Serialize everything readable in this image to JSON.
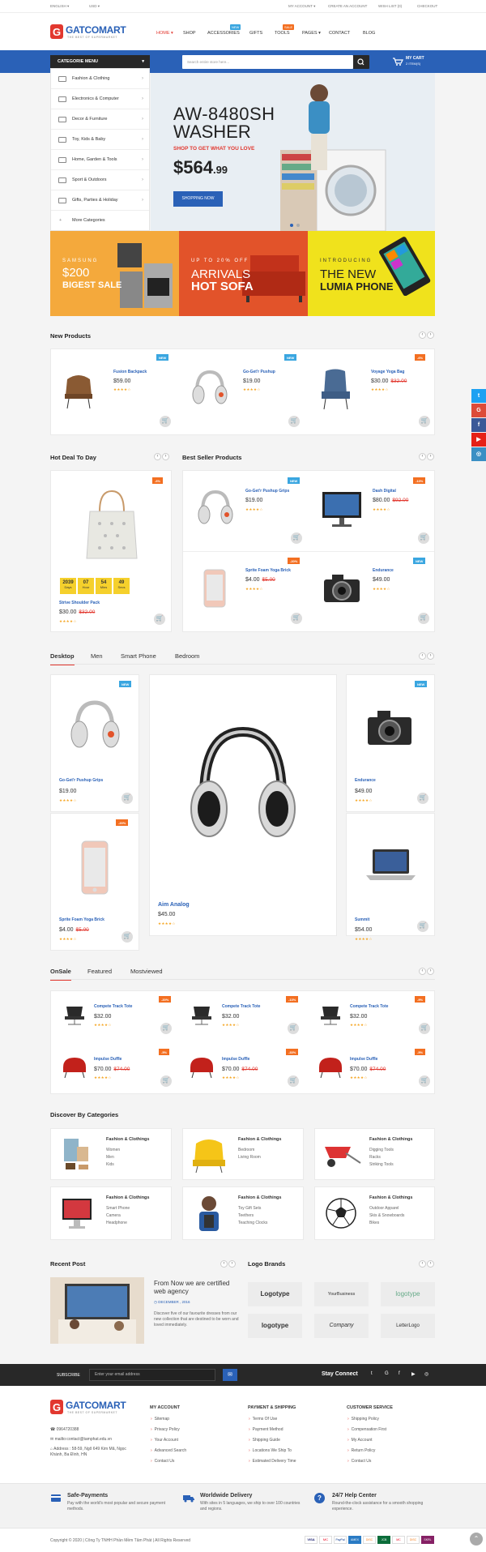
{
  "topbar": {
    "language": "ENGLISH",
    "currency": "USD",
    "my_account": "MY ACCOUNT",
    "create_account": "CREATE AN ACCOUNT",
    "wishlist": "WISH LIST (0)",
    "checkout": "CHECKOUT"
  },
  "header": {
    "logo_letter": "G",
    "logo_name": "GATCOMART",
    "logo_tagline": "THE BEST OF SUPERMARKET",
    "nav": [
      {
        "label": "Home"
      },
      {
        "label": "Shop"
      },
      {
        "label": "Accessories",
        "badge": "NEW"
      },
      {
        "label": "Gifts"
      },
      {
        "label": "Tools",
        "badge": "SALE"
      },
      {
        "label": "Pages"
      },
      {
        "label": "Contact"
      },
      {
        "label": "Blog"
      }
    ]
  },
  "catmenu": {
    "title": "CATEGORIE MENU",
    "items": [
      "Fashion & Clothing",
      "Electronics & Computer",
      "Decor & Furniture",
      "Toy, Kids & Baby",
      "Home, Garden & Tools",
      "Sport & Outdoors",
      "Gifts, Parties & Holiday",
      "More Categories"
    ]
  },
  "search": {
    "placeholder": "Search entire store here..."
  },
  "cart": {
    "title": "MY CART",
    "count": "2 ITEM(S)"
  },
  "hero": {
    "title1": "AW-8480SH",
    "title2": "WASHER",
    "subtitle": "SHOP TO GET WHAT YOU LOVE",
    "price_main": "$564",
    "price_cents": ".99",
    "button": "SHOPPING NOW"
  },
  "promos": [
    {
      "l1": "SAMSUNG",
      "l2": "$200",
      "l3": "BIGEST SALE",
      "bg": "#f4a93c"
    },
    {
      "l1": "UP TO 20% OFF",
      "l2": "ARRIVALS",
      "l3": "HOT SOFA",
      "bg": "#e2532a"
    },
    {
      "l1": "INTRODUCING",
      "l2": "THE NEW",
      "l3": "LUMIA PHONE",
      "bg": "#f0e21c"
    }
  ],
  "new_products": {
    "title": "New Products",
    "items": [
      {
        "name": "Fusion Backpack",
        "price": "$59.00",
        "tag": "NEW"
      },
      {
        "name": "Go-Get'r Pushup",
        "price": "$19.00",
        "tag": "NEW"
      },
      {
        "name": "Voyage Yoga Bag",
        "price": "$30.00",
        "old": "$32.00",
        "tag": "-6%"
      }
    ]
  },
  "hot_deal": {
    "title": "Hot Deal To Day",
    "tag": "-6%",
    "countdown": [
      {
        "v": "2039",
        "l": "Days"
      },
      {
        "v": "07",
        "l": "Hour"
      },
      {
        "v": "54",
        "l": "Mins"
      },
      {
        "v": "49",
        "l": "Secs"
      }
    ],
    "name": "Strive Shoulder Pack",
    "price": "$30.00",
    "old": "$32.00"
  },
  "best_seller": {
    "title": "Best Seller Products",
    "items": [
      {
        "name": "Go-Get'r Pushup Grips",
        "price": "$19.00",
        "tag": "NEW"
      },
      {
        "name": "Dash Digital",
        "price": "$80.00",
        "old": "$92.00",
        "tag": "-13%"
      },
      {
        "name": "Sprite Foam Yoga Brick",
        "price": "$4.00",
        "old": "$5.00",
        "tag": "-20%"
      },
      {
        "name": "Endurance",
        "price": "$49.00",
        "tag": "NEW"
      }
    ]
  },
  "tabs1": {
    "items": [
      "Desktop",
      "Men",
      "Smart Phone",
      "Bedroom"
    ]
  },
  "desktop": {
    "items": [
      {
        "name": "Go-Get'r Pushup Grips",
        "price": "$19.00",
        "tag": "NEW"
      },
      {
        "name": "Aim Analog",
        "price": "$45.00"
      },
      {
        "name": "Endurance",
        "price": "$49.00",
        "tag": "NEW"
      },
      {
        "name": "Sprite Foam Yoga Brick",
        "price": "$4.00",
        "old": "$5.00",
        "tag": "-20%"
      },
      {
        "name": "Summit",
        "price": "$54.00"
      }
    ]
  },
  "tabs2": {
    "items": [
      "OnSale",
      "Featured",
      "Mostviewed"
    ]
  },
  "onsale": {
    "items": [
      {
        "name": "Compete Track Tote",
        "price": "$32.00",
        "tag": "-20%"
      },
      {
        "name": "Compete Track Tote",
        "price": "$32.00",
        "tag": "-13%"
      },
      {
        "name": "Compete Track Tote",
        "price": "$32.00",
        "tag": "-9%"
      },
      {
        "name": "Impulse Duffle",
        "price": "$70.00",
        "old": "$74.00",
        "tag": "-5%"
      },
      {
        "name": "Impulse Duffle",
        "price": "$70.00",
        "old": "$74.00",
        "tag": "-33%"
      },
      {
        "name": "Impulse Duffle",
        "price": "$70.00",
        "old": "$74.00",
        "tag": "-5%"
      }
    ]
  },
  "discover": {
    "title": "Discover By Categories",
    "items": [
      {
        "h": "Fashion & Clothings",
        "l": [
          "Women",
          "Men",
          "Kids"
        ]
      },
      {
        "h": "Fashion & Clothings",
        "l": [
          "Bedroom",
          "Living Room"
        ]
      },
      {
        "h": "Fashion & Clothings",
        "l": [
          "Digging Tools",
          "Racks",
          "Striking Tools"
        ]
      },
      {
        "h": "Fashion & Clothings",
        "l": [
          "Smart Phone",
          "Camera",
          "Headphone"
        ]
      },
      {
        "h": "Fashion & Clothings",
        "l": [
          "Toy Gift Sets",
          "Teethers",
          "Teaching Clocks"
        ]
      },
      {
        "h": "Fashion & Clothings",
        "l": [
          "Outdoor Apparel",
          "Skis & Snowboards",
          "Bikes"
        ]
      }
    ]
  },
  "recent_post": {
    "title": "Recent Post",
    "post_title": "From Now we are certified web agency",
    "date": "DECEMBER , 2016",
    "excerpt": "Discover five of our favourite dresses from our new collection that are destined to be worn and loved immediately."
  },
  "logo_brands": {
    "title": "Logo Brands",
    "items": [
      "Logotype",
      "YourBusiness",
      "logotype",
      "logotype",
      "Company",
      "LetterLogo"
    ]
  },
  "subscribe": {
    "label": "SUBSCRIBE",
    "placeholder": "Enter your email address",
    "stay": "Stay Connect"
  },
  "footer": {
    "phone": "0964720388",
    "email": "mailto:contact@tamphat.edu.vn",
    "address": "Address : 58-59, Ngõ 649 Kim Mã, Ngọc Khánh, Ba Đình, HN",
    "cols": [
      {
        "h": "MY ACCOUNT",
        "items": [
          "Sitemap",
          "Privacy Policy",
          "Your Account",
          "Advanced Search",
          "Contact Us"
        ]
      },
      {
        "h": "PAYMENT & SHIPPING",
        "items": [
          "Terms Of Use",
          "Payment Method",
          "Shipping Guide",
          "Locations We Ship To",
          "Estimated Delivery Time"
        ]
      },
      {
        "h": "CUSTOMER SERVICE",
        "items": [
          "Shipping Policy",
          "Compensation First",
          "My Account",
          "Return Policy",
          "Contact Us"
        ]
      }
    ]
  },
  "services": [
    {
      "h": "Safe-Payments",
      "t": "Pay with the world's most popular and secure payment methods."
    },
    {
      "h": "Worldwide Delivery",
      "t": "With sites in 5 languages, we ship to over 100 countries and regions."
    },
    {
      "h": "24/7 Help Center",
      "t": "Round-the-clock assistance for a smooth shopping experience."
    }
  ],
  "copyright": "Copyright © 2020 | Công Ty TNHH Phần Mềm Tâm Phát | All Rights Reserved",
  "payments": [
    "VISA",
    "MC",
    "PayPal",
    "AMEX",
    "DISC",
    "JCB",
    "MC",
    "DISC",
    "SKRL"
  ],
  "social": [
    {
      "t": "t",
      "c": "#1da1f2"
    },
    {
      "t": "G",
      "c": "#dd4b39"
    },
    {
      "t": "f",
      "c": "#3b5998"
    },
    {
      "t": "▶",
      "c": "#e62117"
    },
    {
      "t": "◎",
      "c": "#3b8fc4"
    }
  ],
  "colors": {
    "brand": "#2a61b7",
    "accent": "#e2382f",
    "sale": "#f36f21",
    "new": "#3aa6e0"
  }
}
